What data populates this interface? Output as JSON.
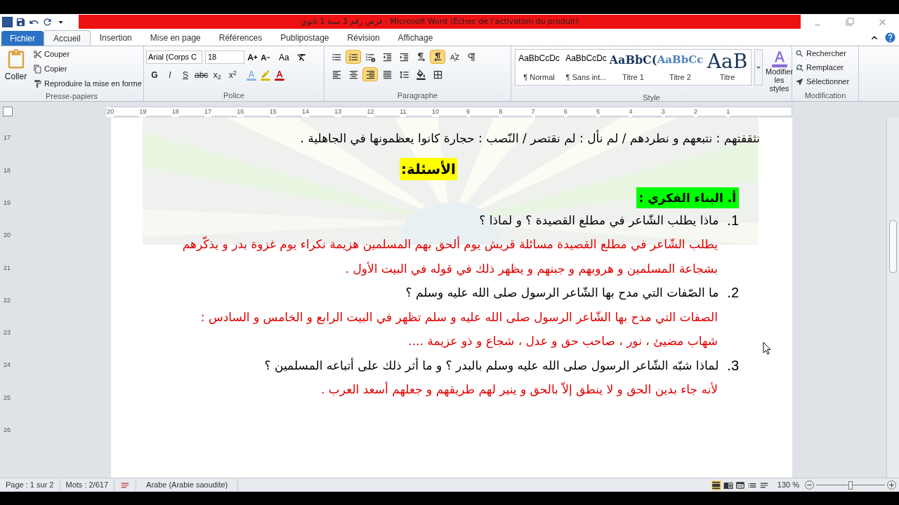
{
  "window": {
    "title": "فرض رقم 3 سنة 1 ثانوي  -  Microsoft Word (Échec de l'activation du produit)"
  },
  "tabs": [
    {
      "label": "Fichier",
      "kind": "file",
      "selected": false
    },
    {
      "label": "Accueil",
      "kind": "tab",
      "selected": true
    },
    {
      "label": "Insertion",
      "kind": "tab",
      "selected": false
    },
    {
      "label": "Mise en page",
      "kind": "tab",
      "selected": false
    },
    {
      "label": "Références",
      "kind": "tab",
      "selected": false
    },
    {
      "label": "Publipostage",
      "kind": "tab",
      "selected": false
    },
    {
      "label": "Révision",
      "kind": "tab",
      "selected": false
    },
    {
      "label": "Affichage",
      "kind": "tab",
      "selected": false
    }
  ],
  "clipboard": {
    "label": "Presse-papiers",
    "paste": "Coller",
    "items": [
      {
        "kind": "cut",
        "label": "Couper"
      },
      {
        "kind": "copy",
        "label": "Copier"
      },
      {
        "kind": "format-painter",
        "label": "Reproduire la mise en forme"
      }
    ]
  },
  "font": {
    "label": "Police",
    "font_name": "Arial (Corps C",
    "font_size": "18",
    "change_case": "Aa",
    "formats": [
      {
        "kind": "bold",
        "label": "G"
      },
      {
        "kind": "italic",
        "label": "I"
      },
      {
        "kind": "underline",
        "label": "S"
      },
      {
        "kind": "strike",
        "label": "abc"
      },
      {
        "kind": "sub",
        "label": "x$_{2}$"
      },
      {
        "kind": "sup",
        "label": "x$^{2}$"
      }
    ]
  },
  "paragraph": {
    "label": "Paragraphe",
    "row1": [
      {
        "kind": "bullets",
        "selected": false
      },
      {
        "kind": "numbering",
        "selected": true
      },
      {
        "kind": "multilevel",
        "selected": false
      },
      {
        "kind": "outdent",
        "selected": false
      },
      {
        "kind": "indent",
        "selected": false
      },
      {
        "kind": "ltr",
        "selected": false
      },
      {
        "kind": "rtl",
        "selected": true
      },
      {
        "kind": "sort",
        "selected": false
      },
      {
        "kind": "marks",
        "selected": false
      }
    ],
    "row2": [
      {
        "kind": "align-left",
        "selected": false
      },
      {
        "kind": "align-center",
        "selected": false
      },
      {
        "kind": "align-right",
        "selected": true
      },
      {
        "kind": "justify",
        "selected": false
      },
      {
        "kind": "spacing",
        "selected": false
      },
      {
        "kind": "shading",
        "selected": false
      },
      {
        "kind": "borders",
        "selected": false
      }
    ]
  },
  "styles": {
    "label": "Style",
    "items": [
      {
        "kind": "normal",
        "preview": "AaBbCcDc",
        "name": "¶ Normal"
      },
      {
        "kind": "plain",
        "preview": "AaBbCcDc",
        "name": "¶ Sans int..."
      },
      {
        "kind": "heading1",
        "preview": "AaBbC(",
        "name": "Titre 1"
      },
      {
        "kind": "heading2",
        "preview": "AaBbCc",
        "name": "Titre 2"
      },
      {
        "kind": "title",
        "preview": "AaB",
        "name": "Titre"
      }
    ],
    "modify": "Modifier les styles"
  },
  "editing": {
    "label": "Modification",
    "items": [
      {
        "kind": "find",
        "label": "Rechercher"
      },
      {
        "kind": "replace",
        "label": "Remplacer"
      },
      {
        "kind": "select",
        "label": "Sélectionner"
      }
    ]
  },
  "ruler": [
    "20",
    "19",
    "18",
    "17",
    "16",
    "15",
    "14",
    "13",
    "12",
    "11",
    "10",
    "9",
    "8",
    "7",
    "6",
    "5",
    "4",
    "3",
    "2",
    "1"
  ],
  "vertical_ruler": [
    "17",
    "18",
    "19",
    "20",
    "21",
    "22",
    "23",
    "24",
    "25",
    "26"
  ],
  "document": [
    {
      "kind": "text",
      "text": "نثقفتهم : نتبعهم و نطردهم / لم نأل : لم نقتصر / النّصب : حجارة كانوا يعظمونها في الجاهلية ."
    },
    {
      "kind": "heading",
      "text": "الأسئلة:"
    },
    {
      "kind": "section",
      "number": "أ.",
      "text": "البناء الفكري :"
    },
    {
      "kind": "question",
      "number": "1.",
      "text": "ماذا يطلب الشّاعر في مطلع القصيدة ؟ و لماذا ؟"
    },
    {
      "kind": "answer",
      "text": "يطلب الشّاعر في مطلع القصيدة  مسائلة  قريش يوم ألحق بهم المسلمين هزيمة نكراء يوم غزوة بدر و يذكّرهم بشجاعة المسلمين  و  هروبهم و جبنهم و يظهر ذلك في قوله في البيت الأول ."
    },
    {
      "kind": "question",
      "number": "2.",
      "text": "ما الصّفات التي مدح بها الشّاعر الرسول صلى الله عليه وسلم ؟"
    },
    {
      "kind": "answer",
      "text": "الصفات التي مدح بها الشّاعر الرسول صلى الله عليه و سلم تظهر في البيت الرابع  و  الخامس و السادس  :"
    },
    {
      "kind": "answer",
      "text": "شهاب مضيئ ، نور ، صاحب حق و عدل ، شجاع و ذو عزيمة ...."
    },
    {
      "kind": "question",
      "number": "3.",
      "text": "لماذا شبّه الشّاعر الرسول صلى الله عليه وسلم بالبدر ؟ و ما أثر ذلك على أتباعه المسلمين ؟"
    },
    {
      "kind": "answer",
      "text": "لأنه جاء بدين الحق و لا ينطق إلاّ بالحق و ينير لهم طريقهم و جعلهم أسعد العرب ."
    }
  ],
  "status_bar": {
    "page": "Page : 1 sur 2",
    "words": "Mots : 2/617",
    "language": "Arabe (Arabie saoudite)",
    "zoom": "130 %",
    "zoom_slider": {
      "level": 0.5
    }
  }
}
